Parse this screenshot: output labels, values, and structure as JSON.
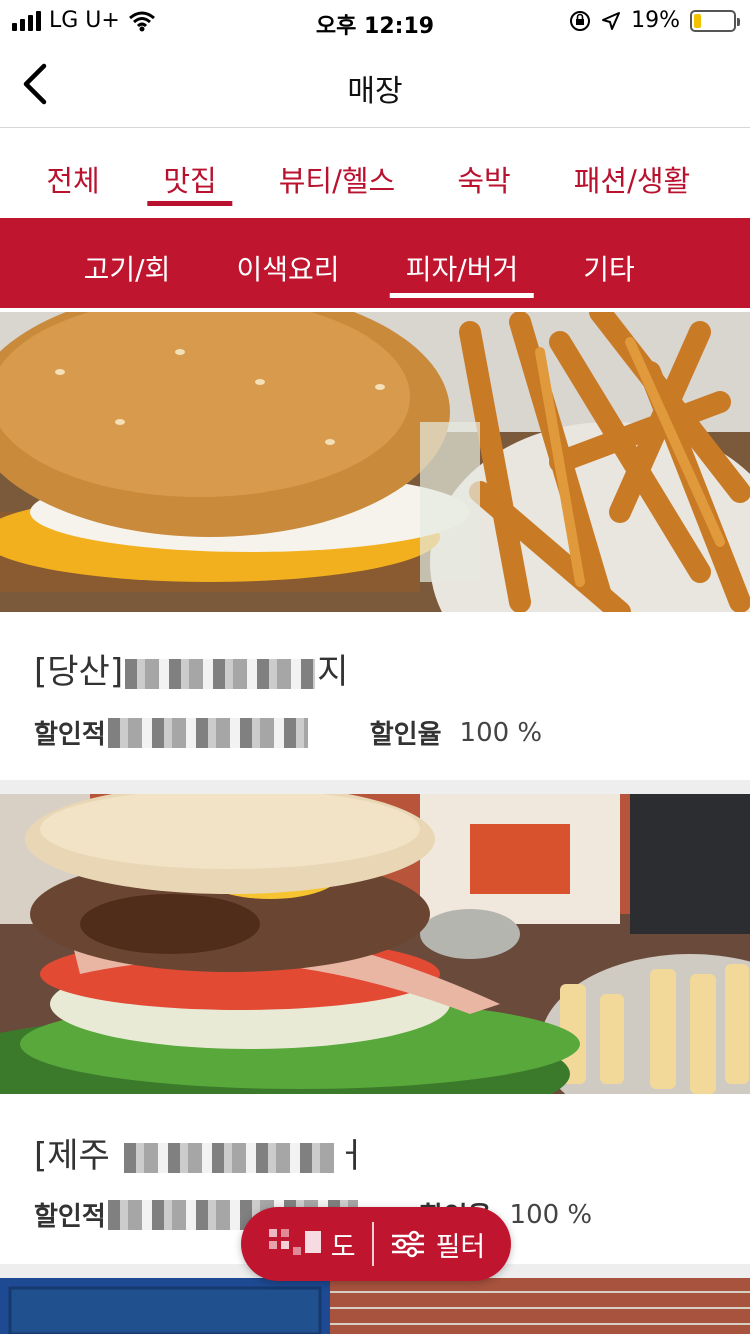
{
  "status_bar": {
    "carrier": "LG U+",
    "time": "오후 12:19",
    "battery_percent": "19%",
    "battery_level": 0.19
  },
  "header": {
    "title": "매장",
    "back_icon": "chevron-left-icon"
  },
  "category_tabs": [
    {
      "label": "전체",
      "active": false
    },
    {
      "label": "맛집",
      "active": true
    },
    {
      "label": "뷰티/헬스",
      "active": false
    },
    {
      "label": "숙박",
      "active": false
    },
    {
      "label": "패션/생활",
      "active": false
    }
  ],
  "sub_tabs": [
    {
      "label": "고기/회",
      "active": false
    },
    {
      "label": "이색요리",
      "active": false
    },
    {
      "label": "피자/버거",
      "active": true
    },
    {
      "label": "기타",
      "active": false
    }
  ],
  "stores": [
    {
      "title_prefix": "[당산]",
      "title_suffix": "지",
      "discount_label": "할인적",
      "rate_label": "할인율",
      "rate_value": "100 %"
    },
    {
      "title_prefix": "[제주",
      "title_suffix": "ㅓ",
      "discount_label": "할인적",
      "rate_label": "할인율",
      "rate_value": "100 %"
    }
  ],
  "fab": {
    "map_label": "도",
    "filter_label": "필터",
    "map_icon": "map-icon",
    "filter_icon": "sliders-icon"
  },
  "colors": {
    "brand_red": "#c0152f",
    "tab_text_red": "#b8122e"
  }
}
